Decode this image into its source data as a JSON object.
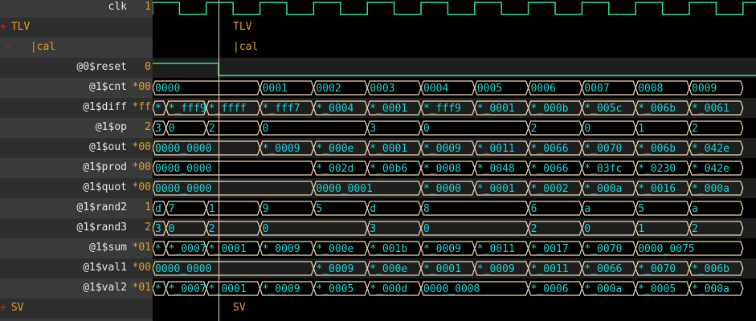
{
  "signals": [
    {
      "name": "clk",
      "value": "1",
      "type": "clock"
    },
    {
      "name": "TLV",
      "type": "scope",
      "expand": "+",
      "indent": 0
    },
    {
      "name": "|cal",
      "type": "scope",
      "expand": "-",
      "indent": 1
    },
    {
      "name": "@0$reset",
      "value": "0",
      "type": "reset"
    },
    {
      "name": "@1$cnt",
      "value": "*00",
      "cells": [
        {
          "label": "0000",
          "span": 2
        },
        {
          "label": "0001"
        },
        {
          "label": "0002"
        },
        {
          "label": "0003"
        },
        {
          "label": "0004"
        },
        {
          "label": "0005"
        },
        {
          "label": "0006"
        },
        {
          "label": "0007"
        },
        {
          "label": "0008"
        },
        {
          "label": "0009"
        }
      ]
    },
    {
      "name": "@1$diff",
      "value": "*ff",
      "cells": [
        {
          "label": "*",
          "span": 0.25
        },
        {
          "label": "*_fff9",
          "span": 0.75
        },
        {
          "label": "*_ffff"
        },
        {
          "label": "*_fff7"
        },
        {
          "label": "*_0004"
        },
        {
          "label": "*_0001"
        },
        {
          "label": "*_fff9"
        },
        {
          "label": "*_0001"
        },
        {
          "label": "*_000b"
        },
        {
          "label": "*_005c"
        },
        {
          "label": "*_006b"
        },
        {
          "label": "*_0061"
        }
      ]
    },
    {
      "name": "@1$op",
      "value": "2",
      "cells": [
        {
          "label": "3",
          "span": 0.25
        },
        {
          "label": "0",
          "span": 0.75
        },
        {
          "label": "2"
        },
        {
          "label": "0",
          "span": 2
        },
        {
          "label": "3"
        },
        {
          "label": "0",
          "span": 2
        },
        {
          "label": "2"
        },
        {
          "label": "0"
        },
        {
          "label": "1"
        },
        {
          "label": "2"
        }
      ]
    },
    {
      "name": "@1$out",
      "value": "*00",
      "cells": [
        {
          "label": "0000_0000",
          "span": 2
        },
        {
          "label": "*_0009"
        },
        {
          "label": "*_000e"
        },
        {
          "label": "*_0001"
        },
        {
          "label": "*_0009"
        },
        {
          "label": "*_0011"
        },
        {
          "label": "*_0066"
        },
        {
          "label": "*_0070"
        },
        {
          "label": "*_006b"
        },
        {
          "label": "*_042e"
        }
      ]
    },
    {
      "name": "@1$prod",
      "value": "*00",
      "cells": [
        {
          "label": "0000_0000",
          "span": 3
        },
        {
          "label": "*_002d"
        },
        {
          "label": "*_00b6"
        },
        {
          "label": "*_0008"
        },
        {
          "label": "*_0048"
        },
        {
          "label": "*_0066"
        },
        {
          "label": "*_03fc"
        },
        {
          "label": "*_0230"
        },
        {
          "label": "*_042e"
        }
      ]
    },
    {
      "name": "@1$quot",
      "value": "*00",
      "cells": [
        {
          "label": "0000_0000",
          "span": 3
        },
        {
          "label": "0000_0001",
          "span": 2
        },
        {
          "label": "*_0000"
        },
        {
          "label": "*_0001"
        },
        {
          "label": "*_0002"
        },
        {
          "label": "*_000a"
        },
        {
          "label": "*_0016"
        },
        {
          "label": "*_000a"
        }
      ]
    },
    {
      "name": "@1$rand2",
      "value": "1",
      "cells": [
        {
          "label": "d",
          "span": 0.25
        },
        {
          "label": "7",
          "span": 0.75
        },
        {
          "label": "1"
        },
        {
          "label": "9"
        },
        {
          "label": "5"
        },
        {
          "label": "d"
        },
        {
          "label": "8",
          "span": 2
        },
        {
          "label": "6"
        },
        {
          "label": "a"
        },
        {
          "label": "5"
        },
        {
          "label": "a"
        }
      ]
    },
    {
      "name": "@1$rand3",
      "value": "2",
      "cells": [
        {
          "label": "3",
          "span": 0.25
        },
        {
          "label": "0",
          "span": 0.75
        },
        {
          "label": "2"
        },
        {
          "label": "0",
          "span": 2
        },
        {
          "label": "3"
        },
        {
          "label": "0",
          "span": 2
        },
        {
          "label": "2"
        },
        {
          "label": "0"
        },
        {
          "label": "1"
        },
        {
          "label": "2"
        }
      ]
    },
    {
      "name": "@1$sum",
      "value": "*01",
      "cells": [
        {
          "label": "*",
          "span": 0.25
        },
        {
          "label": "*_0007",
          "span": 0.75
        },
        {
          "label": "*_0001"
        },
        {
          "label": "*_0009"
        },
        {
          "label": "*_000e"
        },
        {
          "label": "*_001b"
        },
        {
          "label": "*_0009"
        },
        {
          "label": "*_0011"
        },
        {
          "label": "*_0017"
        },
        {
          "label": "*_0070"
        },
        {
          "label": "0000_0075",
          "span": 2
        }
      ]
    },
    {
      "name": "@1$val1",
      "value": "*00",
      "cells": [
        {
          "label": "0000_0000",
          "span": 3
        },
        {
          "label": "*_0009"
        },
        {
          "label": "*_000e"
        },
        {
          "label": "*_0001"
        },
        {
          "label": "*_0009"
        },
        {
          "label": "*_0011"
        },
        {
          "label": "*_0066"
        },
        {
          "label": "*_0070"
        },
        {
          "label": "*_006b"
        }
      ]
    },
    {
      "name": "@1$val2",
      "value": "*01",
      "cells": [
        {
          "label": "*",
          "span": 0.25
        },
        {
          "label": "*_0007",
          "span": 0.75
        },
        {
          "label": "*_0001"
        },
        {
          "label": "*_0009"
        },
        {
          "label": "*_0005"
        },
        {
          "label": "*_000d"
        },
        {
          "label": "0000_0008",
          "span": 2
        },
        {
          "label": "*_0006"
        },
        {
          "label": "*_000a"
        },
        {
          "label": "*_0005"
        },
        {
          "label": "*_000a"
        }
      ]
    },
    {
      "name": "SV",
      "type": "scope",
      "expand": "+",
      "indent": 0
    }
  ],
  "colors": {
    "clock": "#35e090",
    "wave": "#f0d9b5",
    "value_text": "#19d6d6",
    "reset": "#35e090",
    "label": "#e6e6e6",
    "scope": "#e0a020",
    "expander": "#e02020"
  }
}
